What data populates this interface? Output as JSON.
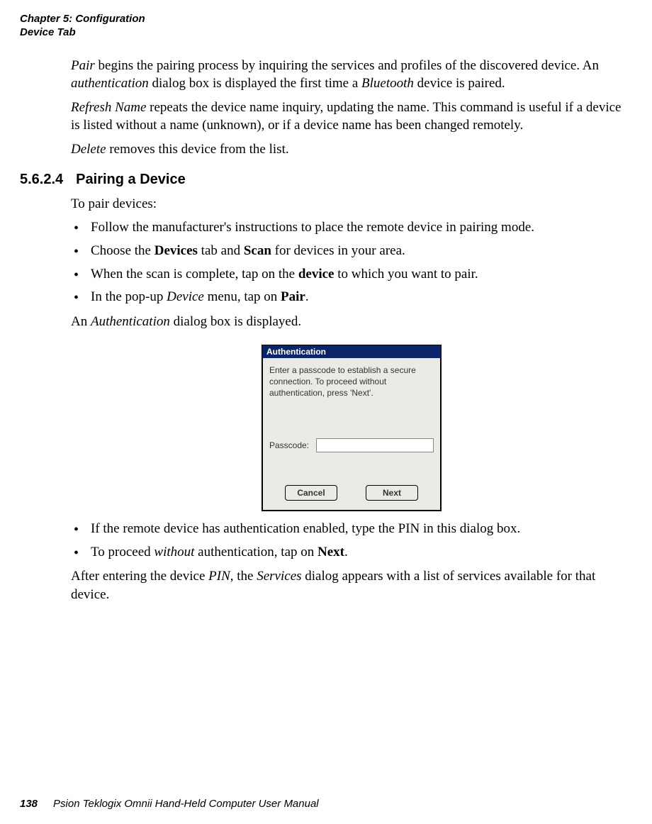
{
  "header": {
    "line1": "Chapter 5: Configuration",
    "line2": "Device Tab"
  },
  "intro": {
    "p1_a": "Pair",
    "p1_b": " begins the pairing process by inquiring the services and profiles of the discovered device. An ",
    "p1_c": "authentication",
    "p1_d": " dialog box is displayed the first time a ",
    "p1_e": "Bluetooth",
    "p1_f": " device is paired.",
    "p2_a": "Refresh Name",
    "p2_b": " repeats the device name inquiry, updating the name. This command is useful if a device is listed without a name (unknown), or if a device name has been changed remotely.",
    "p3_a": "Delete",
    "p3_b": " removes this device from the list."
  },
  "section": {
    "num": "5.6.2.4",
    "title": "Pairing a Device",
    "lead": "To pair devices:"
  },
  "steps_a": [
    {
      "text": "Follow the manufacturer's instructions to place the remote device in pairing mode."
    },
    {
      "pre": "Choose the ",
      "b1": "Devices",
      "mid": " tab and ",
      "b2": "Scan",
      "post": " for devices in your area."
    },
    {
      "pre": "When the scan is complete, tap on the ",
      "b1": "device",
      "post": " to which you want to pair."
    },
    {
      "pre": "In the pop-up ",
      "i1": "Device",
      "mid": " menu, tap on ",
      "b1": "Pair",
      "post": "."
    }
  ],
  "auth_line_a": "An ",
  "auth_line_b": "Authentication",
  "auth_line_c": " dialog box is displayed.",
  "dialog": {
    "title": "Authentication",
    "desc": "Enter a passcode to establish a secure connection. To proceed without authentication, press 'Next'.",
    "passcode_label": "Passcode:",
    "cancel": "Cancel",
    "next": "Next"
  },
  "steps_b": [
    {
      "text": "If the remote device has authentication enabled, type the PIN in this dialog box."
    },
    {
      "pre": "To proceed ",
      "i1": "without",
      "mid": " authentication, tap on ",
      "b1": "Next",
      "post": "."
    }
  ],
  "closing": {
    "a": "After entering the device ",
    "b": "PIN",
    "c": ", the ",
    "d": "Services",
    "e": " dialog appears with a list of services available for that device."
  },
  "footer": {
    "page": "138",
    "book": "Psion Teklogix Omnii Hand-Held Computer User Manual"
  }
}
